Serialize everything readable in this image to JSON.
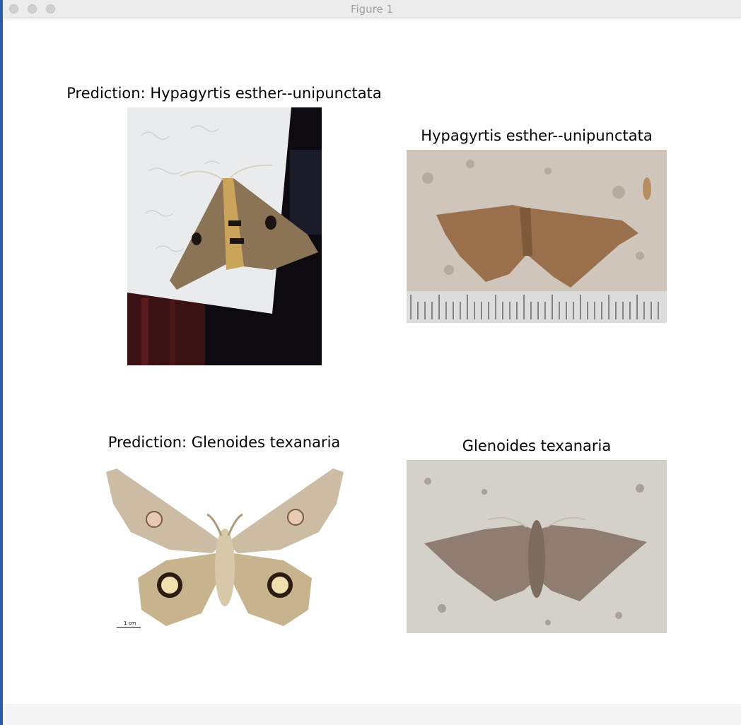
{
  "window": {
    "title": "Figure 1"
  },
  "panels": [
    {
      "title": "Prediction: Hypagyrtis esther--unipunctata",
      "image": "moth-photo-prediction"
    },
    {
      "title": "Hypagyrtis esther--unipunctata",
      "image": "moth-photo-reference"
    },
    {
      "title": "Prediction: Glenoides texanaria",
      "image": "moth-photo-prediction"
    },
    {
      "title": "Glenoides texanaria",
      "image": "moth-photo-reference"
    }
  ],
  "scale_label": "1 cm"
}
